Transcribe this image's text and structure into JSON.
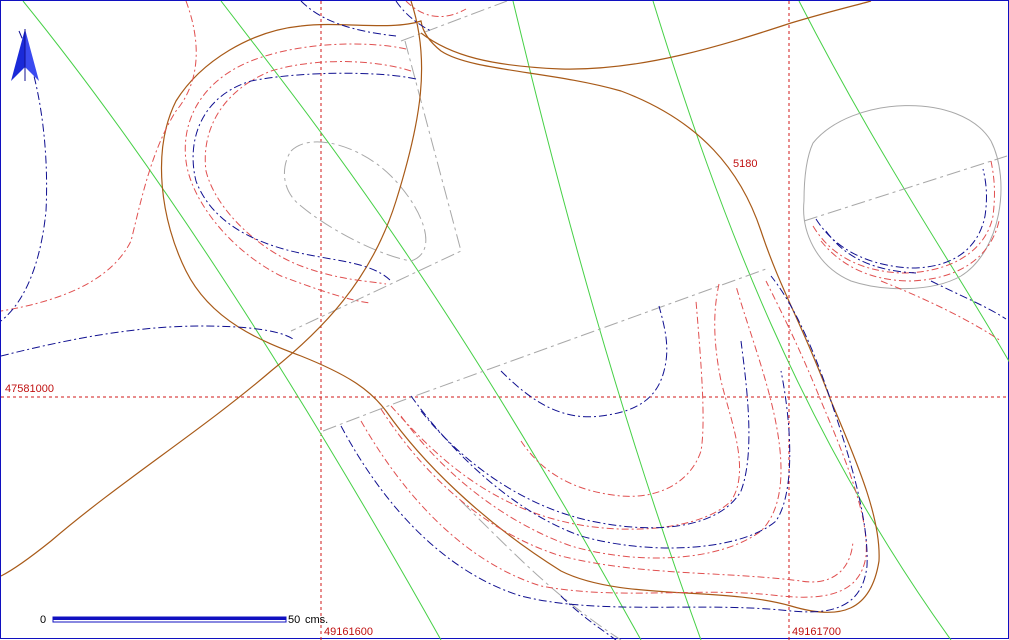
{
  "colors": {
    "frame": "#1010c0",
    "grid": "#d01818",
    "contour_red": "#e05050",
    "contour_blue": "#101090",
    "contour_brown": "#a85a18",
    "green_line": "#46d046",
    "gray_line": "#a8a8a8",
    "label_red": "#c01010",
    "north_arrow": "#1a2ad8",
    "scale_bar": "#1010c0"
  },
  "grid_labels": {
    "northing": "47581000",
    "easting_left": "49161600",
    "easting_right": "49161700"
  },
  "contour_label": "5180",
  "scale_bar": {
    "start_label": "0",
    "end_label": "50",
    "unit_label": "cms."
  },
  "icons": {
    "north_arrow": "north-arrow-icon"
  }
}
